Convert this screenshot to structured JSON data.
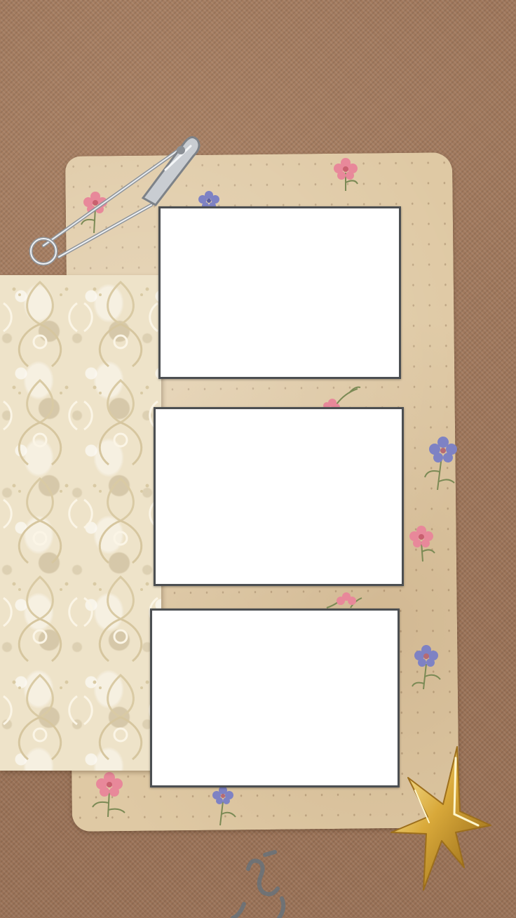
{
  "background": {
    "color": "#a27a5e",
    "texture": "woven-fabric"
  },
  "paper_card": {
    "color": "#dfc9a4",
    "pattern": "floral"
  },
  "lace_paper": {
    "color": "#eee3c9",
    "pattern": "damask"
  },
  "photo_frames": [
    {
      "fill": "#ffffff",
      "border": "#4c4f52"
    },
    {
      "fill": "#ffffff",
      "border": "#4c4f52"
    },
    {
      "fill": "#ffffff",
      "border": "#4c4f52"
    }
  ],
  "decorations": {
    "pin_icon": "safety-pin-icon",
    "star_icon": "gold-star-icon",
    "flower_icon": "flower-icon",
    "flower_colors": [
      "#e8889a",
      "#7e82c4"
    ]
  }
}
